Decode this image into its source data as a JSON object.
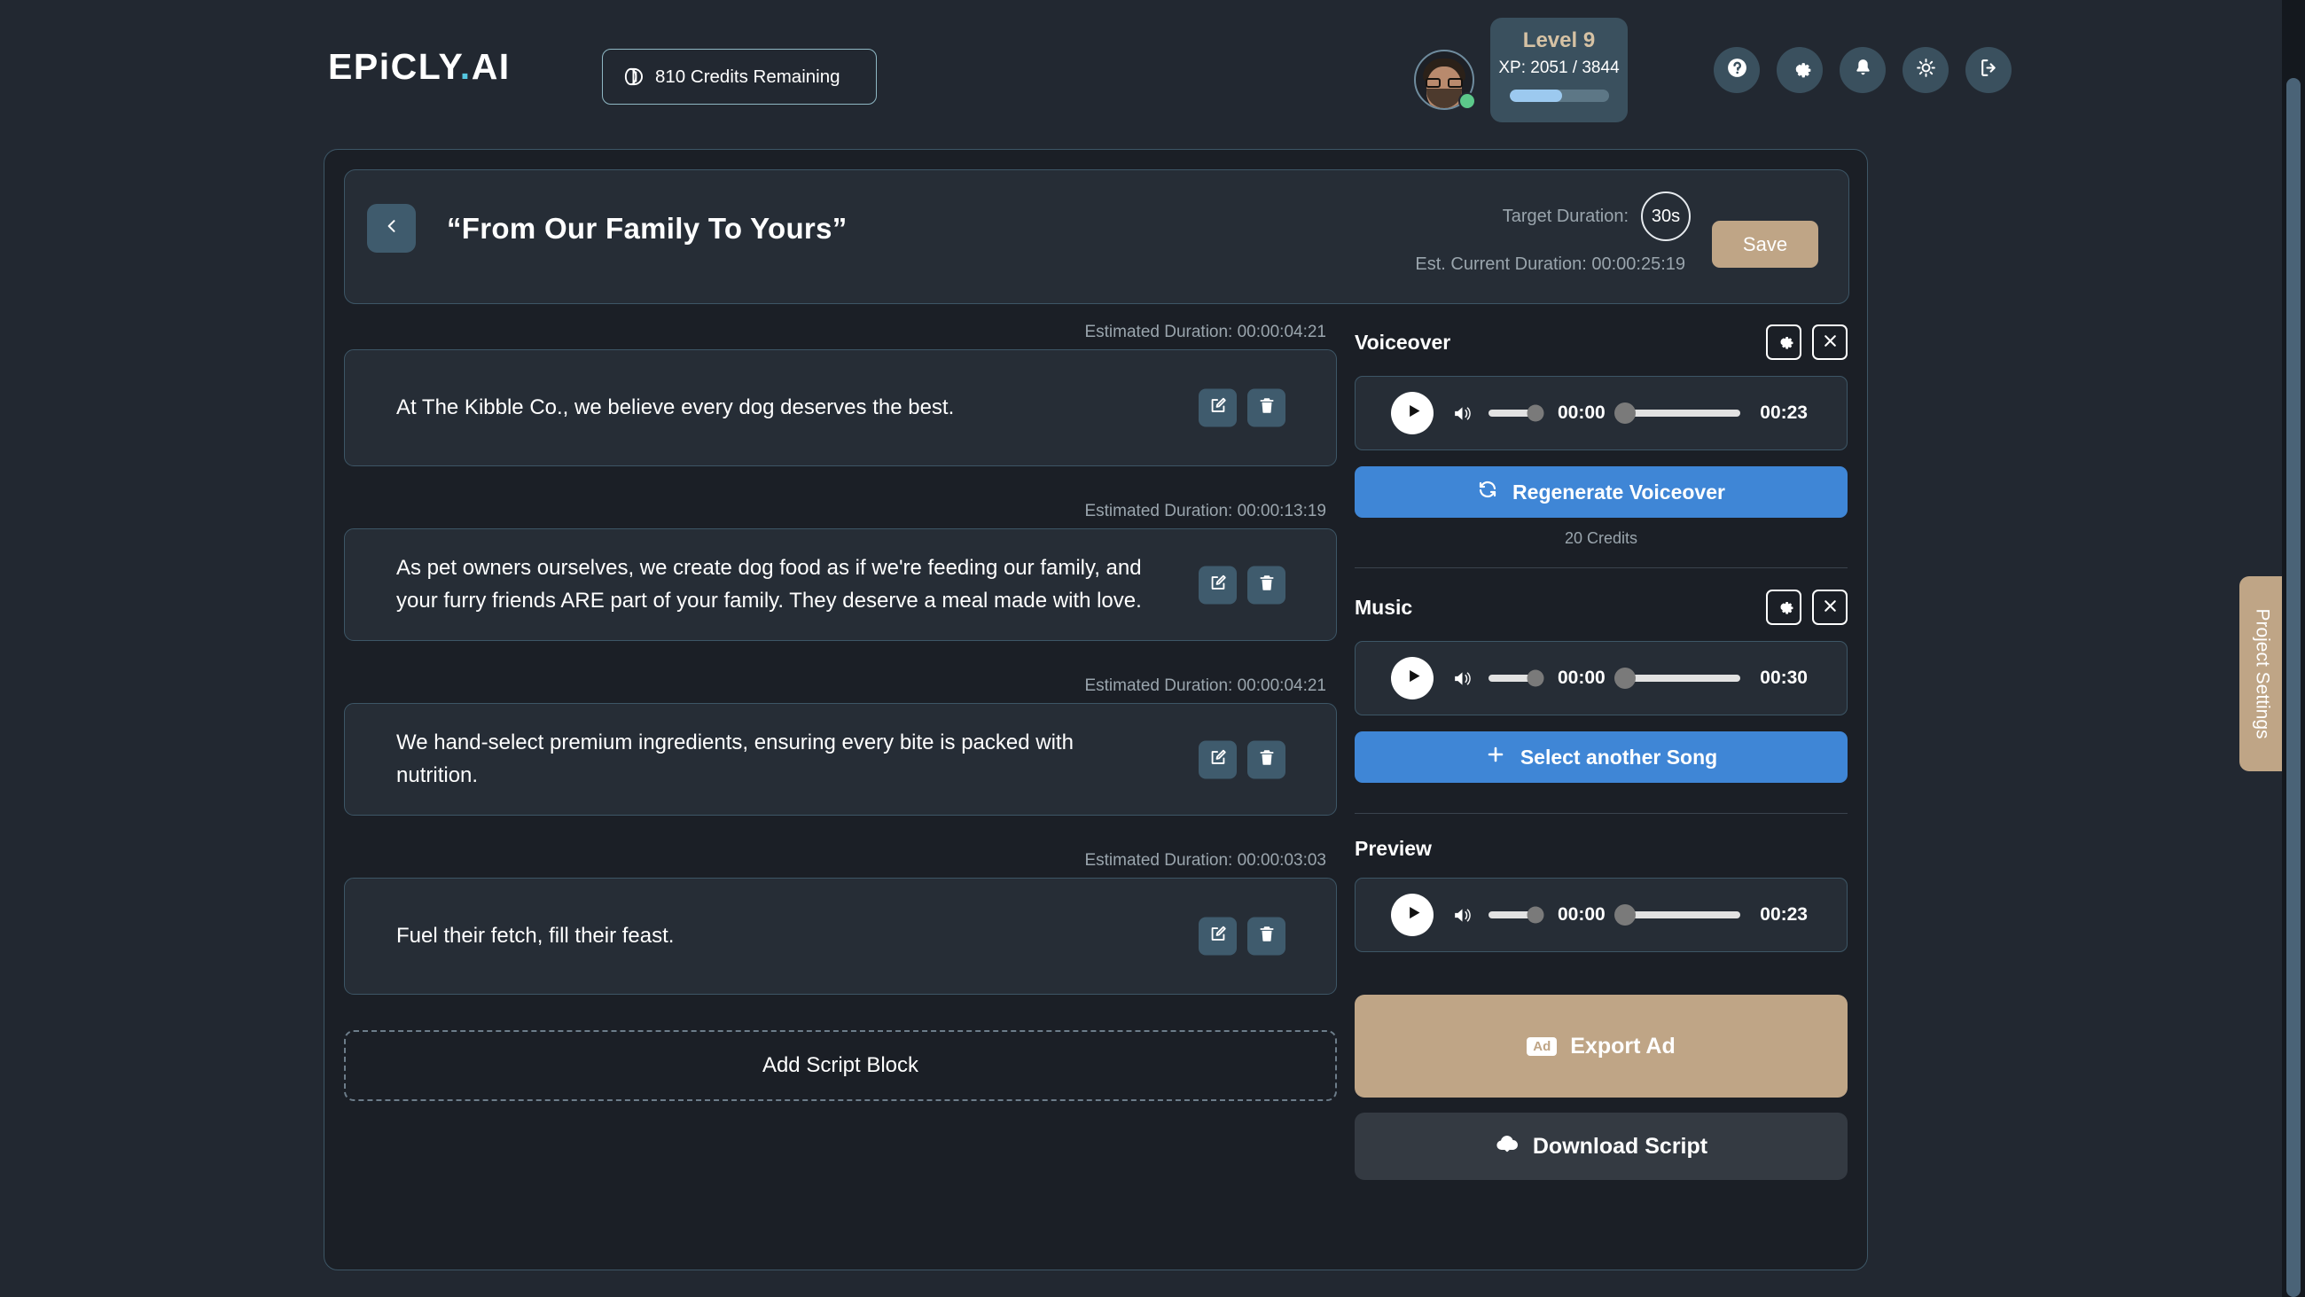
{
  "brand": {
    "name": "EPiCLY",
    "suffix": "AI",
    "dot": "."
  },
  "credits_badge": {
    "label": "810 Credits Remaining",
    "icon": "coin-icon"
  },
  "user": {
    "level_label": "Level 9",
    "xp_label": "XP: 2051 / 3844",
    "xp_percent": 53,
    "status": "online"
  },
  "top_icons": [
    {
      "name": "help-icon",
      "title": "Help"
    },
    {
      "name": "gear-icon",
      "title": "Settings"
    },
    {
      "name": "bell-icon",
      "title": "Notifications"
    },
    {
      "name": "sun-icon",
      "title": "Theme"
    },
    {
      "name": "logout-icon",
      "title": "Log out"
    }
  ],
  "project": {
    "title": "“From Our Family To Yours”",
    "target_duration_label": "Target Duration:",
    "target_duration_value": "30s",
    "current_duration_label": "Est. Current Duration: 00:00:25:19",
    "save_label": "Save",
    "back_icon": "chevron-left-icon"
  },
  "script_blocks": [
    {
      "duration_label": "Estimated Duration: 00:00:04:21",
      "text": "At The Kibble Co., we believe every dog deserves the best."
    },
    {
      "duration_label": "Estimated Duration: 00:00:13:19",
      "text": "As pet owners ourselves, we create dog food as if we're feeding our family, and your furry friends ARE part of your family. They deserve a meal made with love."
    },
    {
      "duration_label": "Estimated Duration: 00:00:04:21",
      "text": "We hand-select premium ingredients, ensuring every bite is packed with nutrition."
    },
    {
      "duration_label": "Estimated Duration: 00:00:03:03",
      "text": "Fuel their fetch, fill their feast."
    }
  ],
  "add_block_label": "Add Script Block",
  "voiceover": {
    "title": "Voiceover",
    "player": {
      "current_time": "00:00",
      "total_time": "00:23",
      "volume_percent": 85,
      "progress_percent": 0
    },
    "action_label": "Regenerate Voiceover",
    "action_icon": "refresh-icon",
    "credits_note": "20 Credits"
  },
  "music": {
    "title": "Music",
    "player": {
      "current_time": "00:00",
      "total_time": "00:30",
      "volume_percent": 85,
      "progress_percent": 0
    },
    "action_label": "Select another Song",
    "action_icon": "plus-icon"
  },
  "preview": {
    "title": "Preview",
    "player": {
      "current_time": "00:00",
      "total_time": "00:23",
      "volume_percent": 85,
      "progress_percent": 0
    }
  },
  "export": {
    "label": "Export Ad",
    "badge": "Ad"
  },
  "download": {
    "label": "Download Script",
    "icon": "cloud-download-icon"
  },
  "project_settings_tab": "Project Settings",
  "colors": {
    "page_bg": "#222831",
    "card_bg": "#1b1f26",
    "panel_bg": "#262d36",
    "accent_blue": "#3f86d6",
    "accent_tan": "#bfa586",
    "slate": "#3f5b6d",
    "border": "#3d5666",
    "muted_text": "#9aa5ad",
    "logo_dot": "#55c7e0",
    "status_green": "#5cc98a"
  }
}
